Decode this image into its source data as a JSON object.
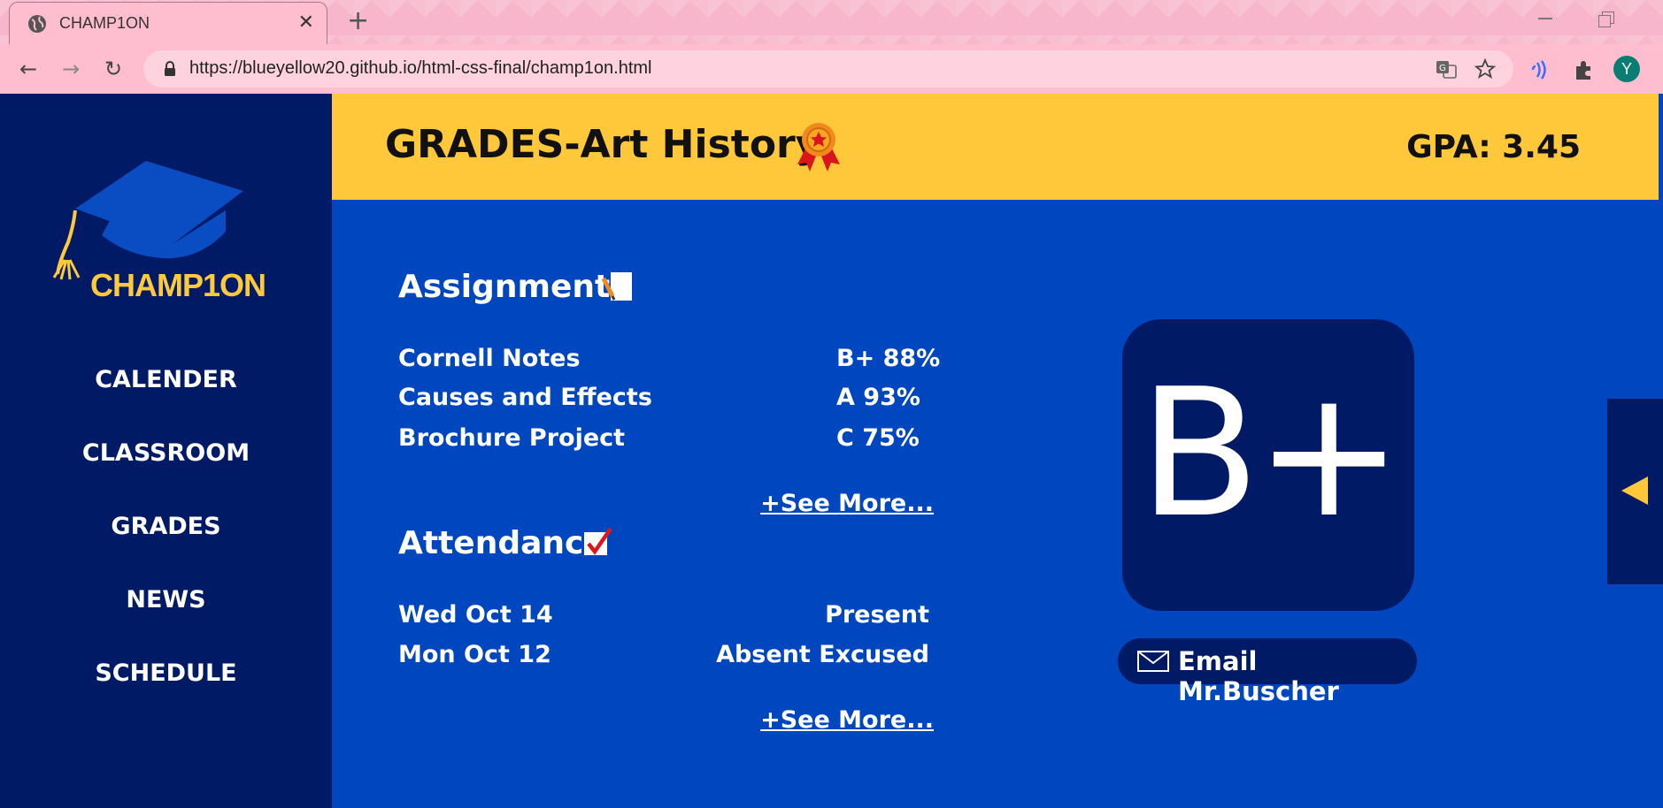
{
  "browser": {
    "tab_title": "CHAMP1ON",
    "close_glyph": "✕",
    "new_tab_glyph": "+",
    "url": "https://blueyellow20.github.io/html-css-final/champ1on.html",
    "profile_initial": "Y",
    "nav": {
      "back": "←",
      "forward": "→",
      "reload": "↻"
    }
  },
  "sidebar": {
    "logo_text": "CHAMP1ON",
    "items": [
      {
        "label": "CALENDER"
      },
      {
        "label": "CLASSROOM"
      },
      {
        "label": "GRADES"
      },
      {
        "label": "NEWS"
      },
      {
        "label": "SCHEDULE"
      }
    ]
  },
  "header": {
    "title": "GRADES-Art History",
    "gpa": "GPA: 3.45"
  },
  "assignments": {
    "title": "Assignments",
    "rows": [
      {
        "name": "Cornell Notes",
        "grade": "B+ 88%"
      },
      {
        "name": "Causes and Effects",
        "grade": "A 93%"
      },
      {
        "name": "Brochure Project",
        "grade": "C 75%"
      }
    ],
    "see_more": "+See More..."
  },
  "attendance": {
    "title": "Attendance",
    "rows": [
      {
        "date": "Wed Oct 14",
        "status": "Present"
      },
      {
        "date": "Mon Oct 12",
        "status": "Absent Excused"
      }
    ],
    "see_more": "+See More..."
  },
  "grade_card": {
    "letter": "B+",
    "email_label": "Email Mr.Buscher"
  },
  "colors": {
    "sidebar": "#001a66",
    "main": "#0047bf",
    "header": "#ffc73a",
    "accent": "#ffc93c",
    "chrome": "#ffbdd0"
  }
}
